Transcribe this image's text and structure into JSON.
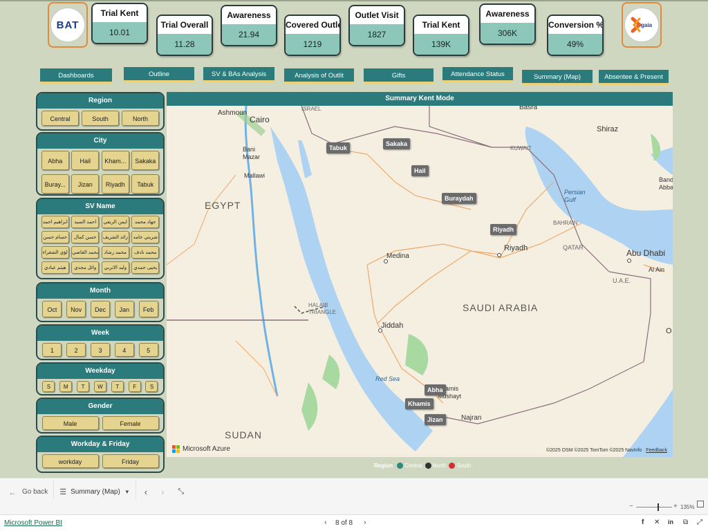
{
  "logos": {
    "left_text": "BAT",
    "right_text": "gaia"
  },
  "kpis": [
    {
      "title": "Trial Kent",
      "value": "10.01"
    },
    {
      "title": "Trial Overall",
      "value": "11.28"
    },
    {
      "title": "Awareness",
      "value": "21.94"
    },
    {
      "title": "Covered Outlet",
      "value": "1219"
    },
    {
      "title": "Outlet Visit",
      "value": "1827"
    },
    {
      "title": "Trial Kent",
      "value": "139K"
    },
    {
      "title": "Awareness",
      "value": "306K"
    },
    {
      "title": "Conversion %",
      "value": "49%"
    }
  ],
  "nav": [
    "Dashboards",
    "Outline",
    "SV & BAs Analysis",
    "Analysis of Outlit",
    "Gifts",
    "Attendance Status",
    "Summary (Map)",
    "Absentee & Present"
  ],
  "slicers": {
    "region": {
      "title": "Region",
      "items": [
        "Central",
        "South",
        "North"
      ]
    },
    "city": {
      "title": "City",
      "items": [
        "Abha",
        "Hail",
        "Kham...",
        "Sakaka",
        "Buray...",
        "Jizan",
        "Riyadh",
        "Tabuk"
      ]
    },
    "sv": {
      "title": "SV Name",
      "items": [
        "جهاد محمد",
        "ايمن الريفي",
        "احمد السيد",
        "ابراهيم احمد",
        "شريتي حامد",
        "زائد الشريف",
        "حسن كمال",
        "حسام حسن",
        "محمد نادف",
        "محمد رشاد",
        "محمد القاضي",
        "لؤي الشقراء",
        "يحيى حمدي",
        "وليد الاتربي",
        "وائل مجدي",
        "هيثم عبادي"
      ]
    },
    "month": {
      "title": "Month",
      "items": [
        "Oct",
        "Nov",
        "Dec",
        "Jan",
        "Feb"
      ]
    },
    "week": {
      "title": "Week",
      "items": [
        "1",
        "2",
        "3",
        "4",
        "5"
      ]
    },
    "weekday": {
      "title": "Weekday",
      "items": [
        "S",
        "M",
        "T",
        "W",
        "T",
        "F",
        "S"
      ]
    },
    "gender": {
      "title": "Gender",
      "items": [
        "Male",
        "Female"
      ]
    },
    "workday": {
      "title": "Workday & Friday",
      "items": [
        "workday",
        "Friday"
      ]
    }
  },
  "map": {
    "title": "Summary Kent Mode",
    "pins": [
      "Tabuk",
      "Sakaka",
      "Hail",
      "Buraydah",
      "Riyadh",
      "Abha",
      "Khamis",
      "Jizan"
    ],
    "places": {
      "ashmoun": "Ashmoun",
      "cairo": "Cairo",
      "israel": "ISRAEL",
      "basra": "Basra",
      "shiraz": "Shiraz",
      "kuwait": "KUWAIT",
      "bani_mazar": "Bani\nMazar",
      "mallawi": "Mallawi",
      "persian_gulf": "Persian\nGulf",
      "bahrain": "BAHRAIN",
      "qatar": "QATAR",
      "riyadh": "Riyadh",
      "medina": "Medina",
      "abu_dhabi": "Abu Dhabi",
      "al_ain": "Al Ain",
      "uae": "U.A.E.",
      "jiddah": "Jiddah",
      "halaib": "HALAIB\nTRIANGLE",
      "red_sea": "Red Sea",
      "khamis_mushayt": "Khamis\nMushayt",
      "najran": "Najran",
      "bandar": "Band\nAbba",
      "o": "O"
    },
    "countries": {
      "egypt": "EGYPT",
      "saudi": "SAUDI ARABIA",
      "sudan": "SUDAN"
    },
    "provider": "Microsoft Azure",
    "attribution": "©2025 OSM  ©2025 TomTom  ©2025 NavInfo",
    "feedback": "Feedback"
  },
  "legend": {
    "title": "Region",
    "items": [
      {
        "label": "Central",
        "color": "#2b8a7c"
      },
      {
        "label": "North",
        "color": "#333333"
      },
      {
        "label": "South",
        "color": "#d32f2f"
      }
    ]
  },
  "pagebar": {
    "go_back": "Go back",
    "page_name": "Summary (Map)"
  },
  "zoom": {
    "level": "135%",
    "fraction": 0.6
  },
  "footer": {
    "brand": "Microsoft Power BI",
    "page_indicator": "8 of 8"
  },
  "colors": {
    "header_teal": "#2b7a7c",
    "kpi_value_bg": "#8cc7ba",
    "chip_yellow": "#e4d48f",
    "logo_border": "#e08a3c",
    "background": "#cfd7c0"
  }
}
